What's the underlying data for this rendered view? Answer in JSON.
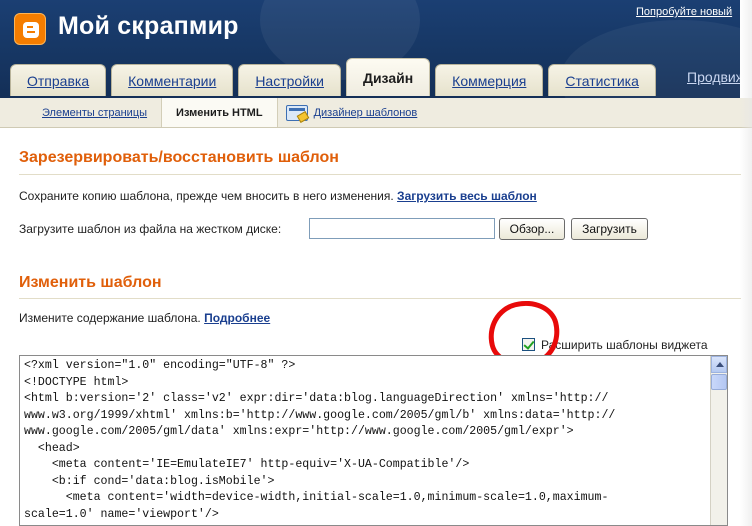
{
  "header": {
    "site_title": "Мой скрапмир",
    "top_link": "Попробуйте новый"
  },
  "tabs": [
    {
      "label": "Отправка",
      "active": false
    },
    {
      "label": "Комментарии",
      "active": false
    },
    {
      "label": "Настройки",
      "active": false
    },
    {
      "label": "Дизайн",
      "active": true
    },
    {
      "label": "Коммерция",
      "active": false
    },
    {
      "label": "Статистика",
      "active": false
    }
  ],
  "promo_tab": "Продвижение",
  "subnav": {
    "page_elements": "Элементы страницы",
    "edit_html": "Изменить HTML",
    "template_designer": "Дизайнер шаблонов"
  },
  "backup": {
    "title": "Зарезервировать/восстановить шаблон",
    "save_text": "Сохраните копию шаблона, прежде чем вносить в него изменения.",
    "download_link": "Загрузить весь шаблон",
    "upload_label": "Загрузите шаблон из файла на жестком диске:",
    "file_input_value": "",
    "browse_button": "Обзор...",
    "upload_button": "Загрузить"
  },
  "edit": {
    "title": "Изменить шаблон",
    "desc": "Измените содержание шаблона.",
    "more_link": "Подробнее",
    "expand_widgets_label": "Расширить шаблоны виджета",
    "expand_widgets_checked": true
  },
  "code_lines": [
    "<?xml version=\"1.0\" encoding=\"UTF-8\" ?>",
    "<!DOCTYPE html>",
    "<html b:version='2' class='v2' expr:dir='data:blog.languageDirection' xmlns='http://",
    "www.w3.org/1999/xhtml' xmlns:b='http://www.google.com/2005/gml/b' xmlns:data='http://",
    "www.google.com/2005/gml/data' xmlns:expr='http://www.google.com/2005/gml/expr'>",
    "  <head>",
    "    <meta content='IE=EmulateIE7' http-equiv='X-UA-Compatible'/>",
    "    <b:if cond='data:blog.isMobile'>",
    "      <meta content='width=device-width,initial-scale=1.0,minimum-scale=1.0,maximum-",
    "scale=1.0' name='viewport'/>"
  ],
  "colors": {
    "header_bg": "#173866",
    "section_title": "#e05f0a",
    "link": "#1a3f8f",
    "annotation": "#e80a0a"
  }
}
